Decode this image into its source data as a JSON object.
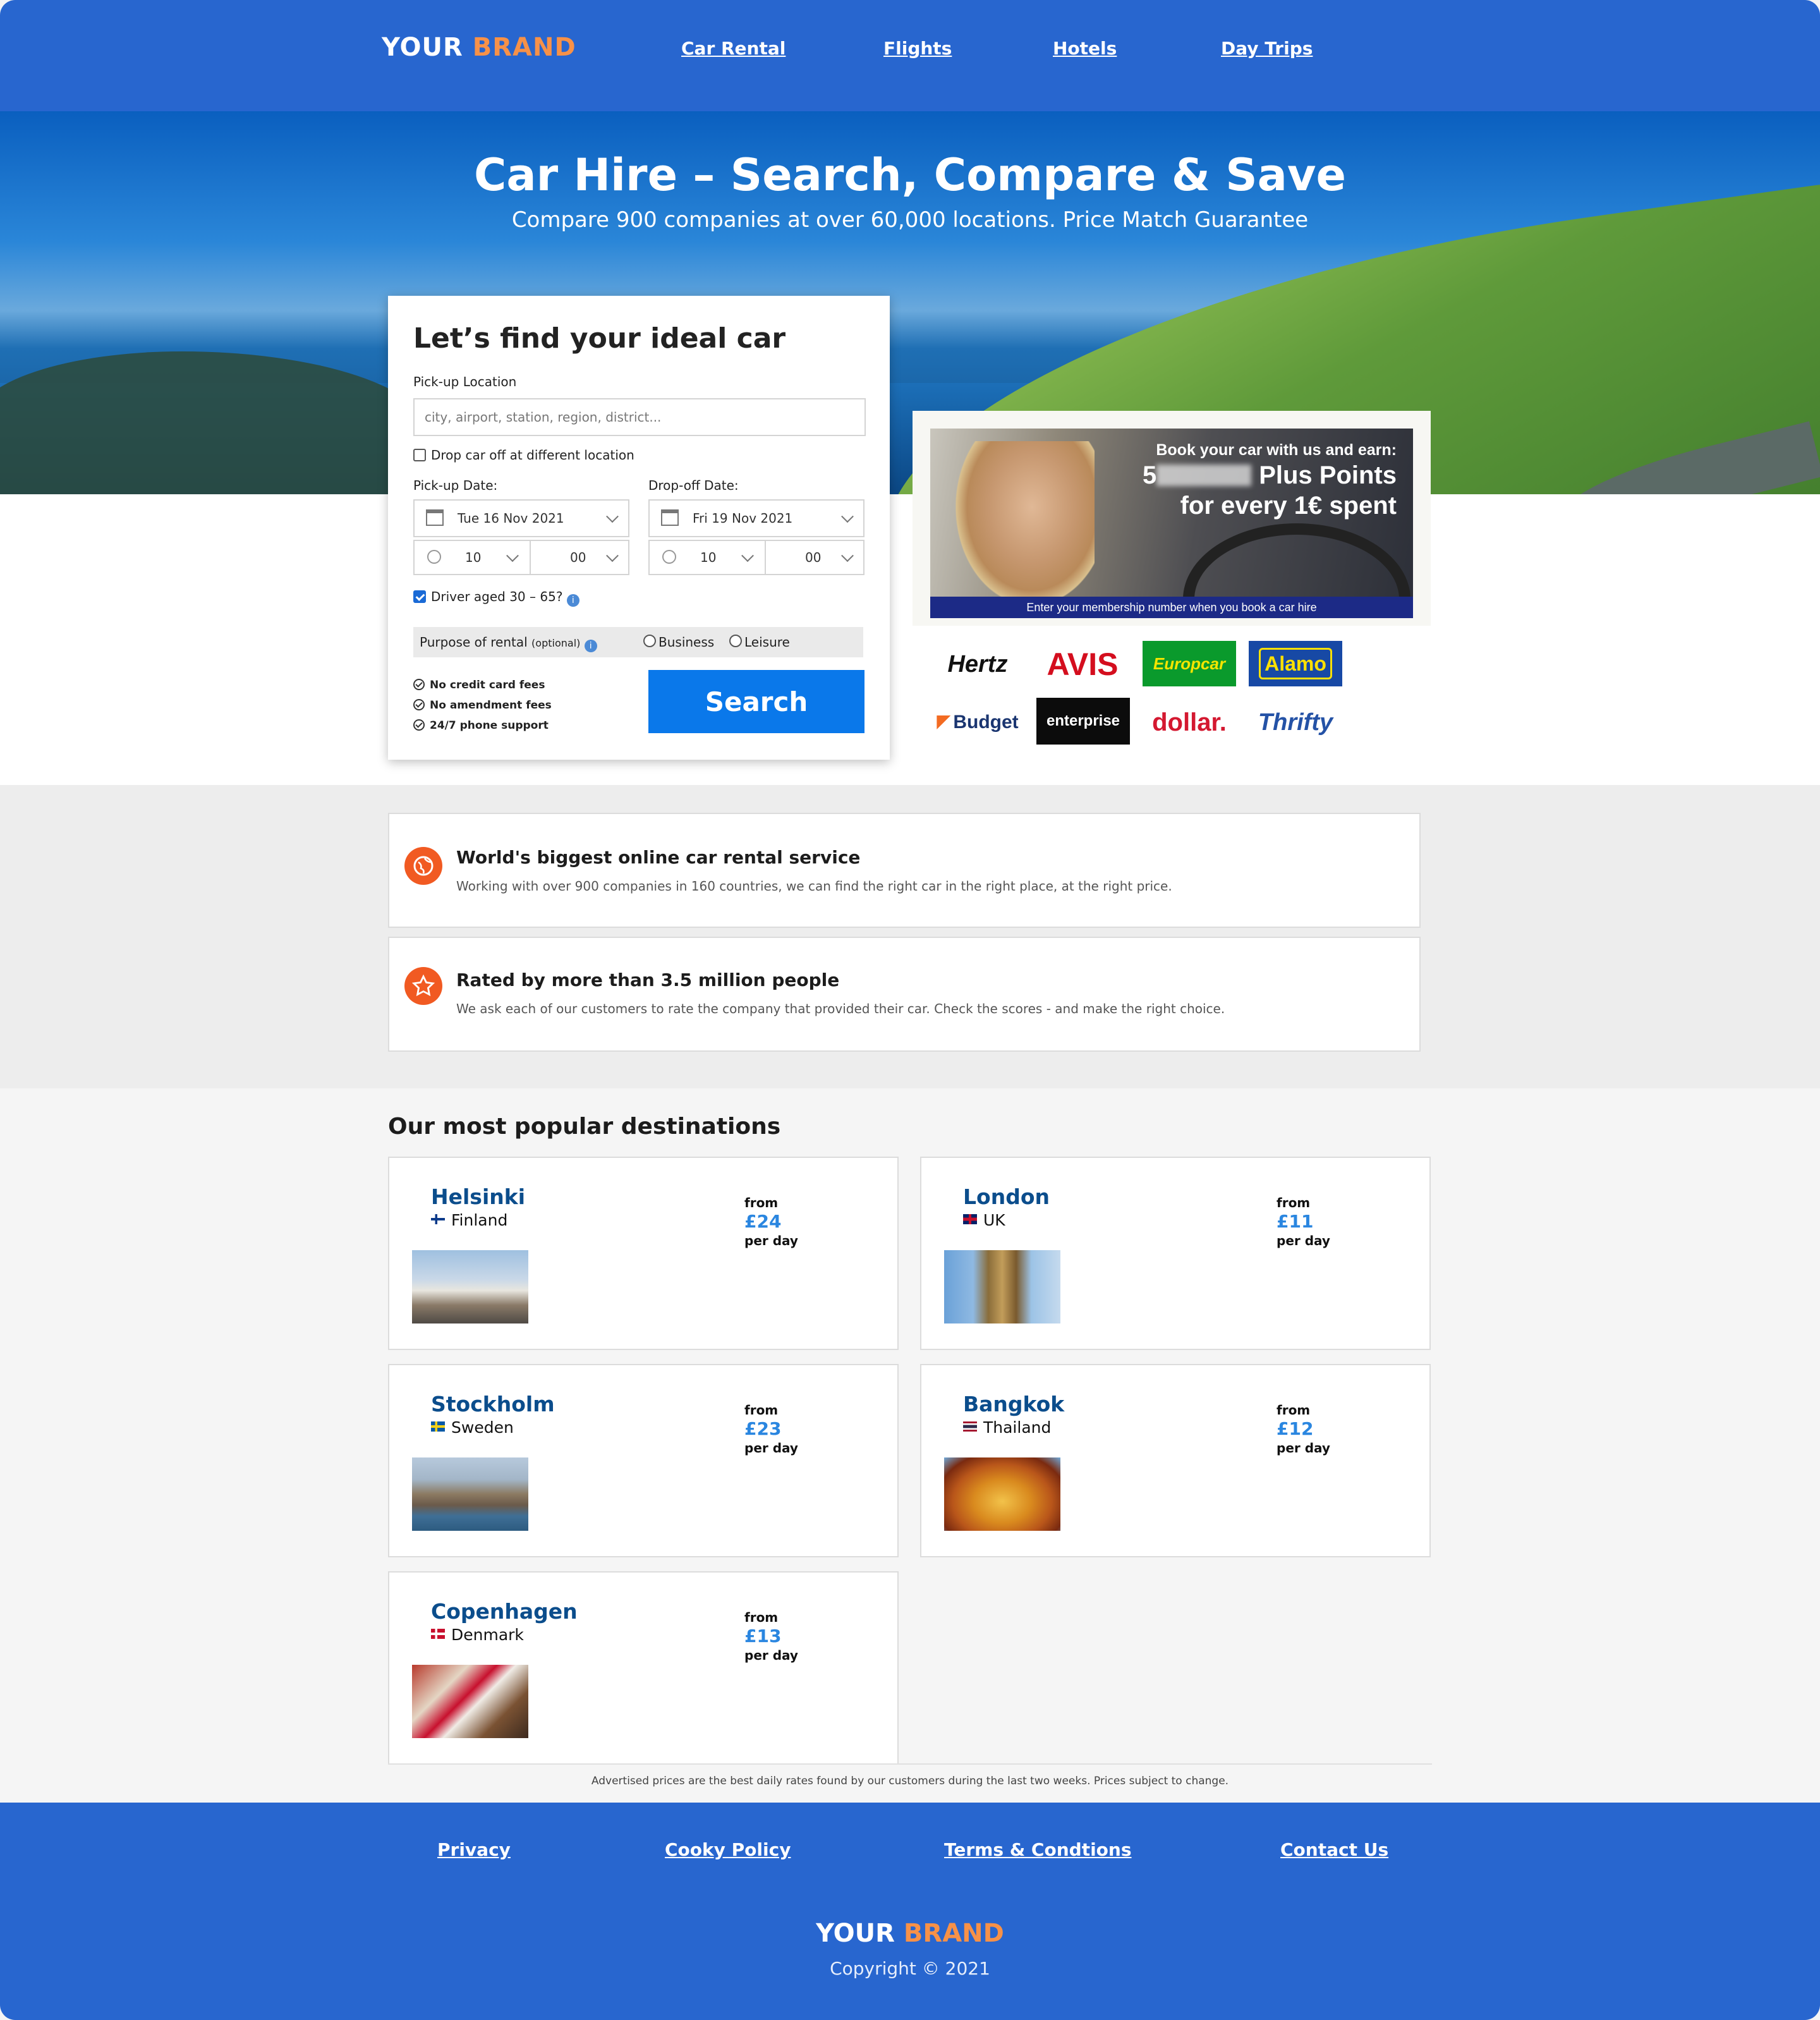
{
  "header": {
    "brand_main": "YOUR",
    "brand_accent": "BRAND",
    "nav": [
      "Car Rental",
      "Flights",
      "Hotels",
      "Day Trips"
    ]
  },
  "hero": {
    "title": "Car Hire – Search, Compare & Save",
    "subtitle": "Compare 900 companies at over 60,000 locations. Price Match Guarantee"
  },
  "search": {
    "heading": "Let’s find your ideal car",
    "pickup_location_label": "Pick-up Location",
    "pickup_location_placeholder": "city, airport, station, region, district...",
    "dropoff_different_label": "Drop car off at different location",
    "pickup_date_label": "Pick-up Date:",
    "dropoff_date_label": "Drop-off Date:",
    "pickup_date": "Tue 16 Nov 2021",
    "dropoff_date": "Fri 19 Nov 2021",
    "pickup_hour": "10",
    "pickup_minute": "00",
    "dropoff_hour": "10",
    "dropoff_minute": "00",
    "driver_age_label": "Driver aged 30 – 65?",
    "purpose_label": "Purpose of rental",
    "purpose_optional": "(optional)",
    "purpose_options": [
      "Business",
      "Leisure"
    ],
    "benefits": [
      "No credit card fees",
      "No amendment fees",
      "24/7 phone support"
    ],
    "search_button": "Search"
  },
  "promo": {
    "line1": "Book your car with us and earn:",
    "line2_prefix": "5",
    "line2_suffix": "Plus Points",
    "line3": "for every 1€ spent",
    "bar": "Enter your membership number when you book a car hire"
  },
  "partners": [
    "Hertz",
    "AVIS",
    "Europcar",
    "Alamo",
    "Budget",
    "enterprise",
    "dollar.",
    "Thrifty"
  ],
  "features": [
    {
      "icon": "globe-icon",
      "title": "World's biggest online car rental service",
      "text": "Working with over 900 companies in 160 countries, we can find the right car in the right place, at the right price."
    },
    {
      "icon": "star-icon",
      "title": "Rated by more than 3.5 million people",
      "text": "We ask each of our customers to rate the company that provided their car. Check the scores - and make the right choice."
    }
  ],
  "destinations_title": "Our most popular destinations",
  "destinations": [
    {
      "city": "Helsinki",
      "country": "Finland",
      "from": "from",
      "price": "£24",
      "per": "per day"
    },
    {
      "city": "London",
      "country": "UK",
      "from": "from",
      "price": "£11",
      "per": "per day"
    },
    {
      "city": "Stockholm",
      "country": "Sweden",
      "from": "from",
      "price": "£23",
      "per": "per day"
    },
    {
      "city": "Bangkok",
      "country": "Thailand",
      "from": "from",
      "price": "£12",
      "per": "per day"
    },
    {
      "city": "Copenhagen",
      "country": "Denmark",
      "from": "from",
      "price": "£13",
      "per": "per day"
    }
  ],
  "disclaimer": "Advertised prices are the best daily rates found by our customers during the last two weeks. Prices subject to change.",
  "footer": {
    "links": [
      "Privacy",
      "Cooky Policy",
      "Terms & Condtions",
      "Contact Us"
    ],
    "brand_main": "YOUR",
    "brand_accent": "BRAND",
    "copyright": "Copyright © 2021"
  },
  "colors": {
    "primary": "#2866cf",
    "accent": "#f79148",
    "button": "#0a78ea",
    "feature_icon": "#f15a22"
  }
}
